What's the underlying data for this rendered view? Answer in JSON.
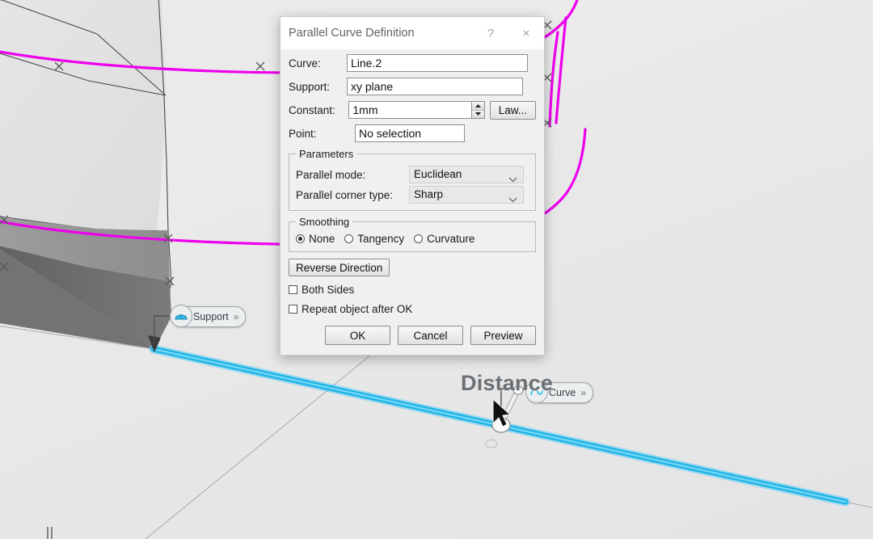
{
  "dialog": {
    "title": "Parallel Curve Definition",
    "help_label": "?",
    "close_label": "×",
    "fields": {
      "curve_label": "Curve:",
      "curve_value": "Line.2",
      "support_label": "Support:",
      "support_value": "xy plane",
      "constant_label": "Constant:",
      "constant_value": "1mm",
      "law_button": "Law...",
      "point_label": "Point:",
      "point_value": "No selection"
    },
    "parameters": {
      "legend": "Parameters",
      "parallel_mode_label": "Parallel mode:",
      "parallel_mode_value": "Euclidean",
      "parallel_corner_label": "Parallel corner type:",
      "parallel_corner_value": "Sharp"
    },
    "smoothing": {
      "legend": "Smoothing",
      "options": [
        {
          "label": "None",
          "selected": true
        },
        {
          "label": "Tangency",
          "selected": false
        },
        {
          "label": "Curvature",
          "selected": false
        }
      ]
    },
    "reverse_direction_label": "Reverse Direction",
    "both_sides_label": "Both Sides",
    "both_sides_checked": false,
    "repeat_object_label": "Repeat object after OK",
    "repeat_object_checked": false,
    "buttons": {
      "ok": "OK",
      "cancel": "Cancel",
      "preview": "Preview"
    }
  },
  "viewport": {
    "distance_annotation": "Distance",
    "support_chip_label": "Support",
    "support_chip_arrows": "»",
    "curve_chip_label": "Curve",
    "curve_chip_arrows": "»",
    "colors": {
      "selected_curve": "#29b6e8",
      "construction_curve": "#ee00ee",
      "surface_light": "#e3e3e3",
      "surface_mid": "#9a9a9a",
      "surface_dark": "#6d6d6d",
      "edge": "#4a4a4a",
      "background": "#e9e9e9"
    }
  }
}
